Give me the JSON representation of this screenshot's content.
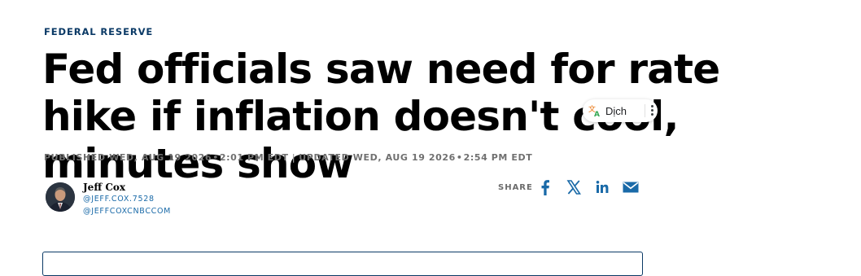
{
  "article": {
    "eyebrow": "FEDERAL RESERVE",
    "headline": "Fed officials saw need for rate hike if inflation doesn't cool, minutes show",
    "published": "PUBLISHED WED, AUG 19 2026",
    "published_time": "2:01 PM EDT",
    "separator": "|",
    "updated": "UPDATED WED, AUG 19 2026",
    "updated_time": "2:54 PM EDT",
    "dot": "•"
  },
  "author": {
    "name": "Jeff Cox",
    "handle_1": "@JEFF.COX.7528",
    "handle_2": "@JEFFCOXCNBCCOM"
  },
  "share": {
    "label": "SHARE",
    "icons": [
      "facebook-icon",
      "x-icon",
      "linkedin-icon",
      "email-icon"
    ],
    "color": "#1a6aa8"
  },
  "translate_popup": {
    "label": "Dịch"
  },
  "colors": {
    "eyebrow": "#0b3a66",
    "headline": "#000000",
    "meta": "#707070",
    "link": "#1a6aa8"
  }
}
